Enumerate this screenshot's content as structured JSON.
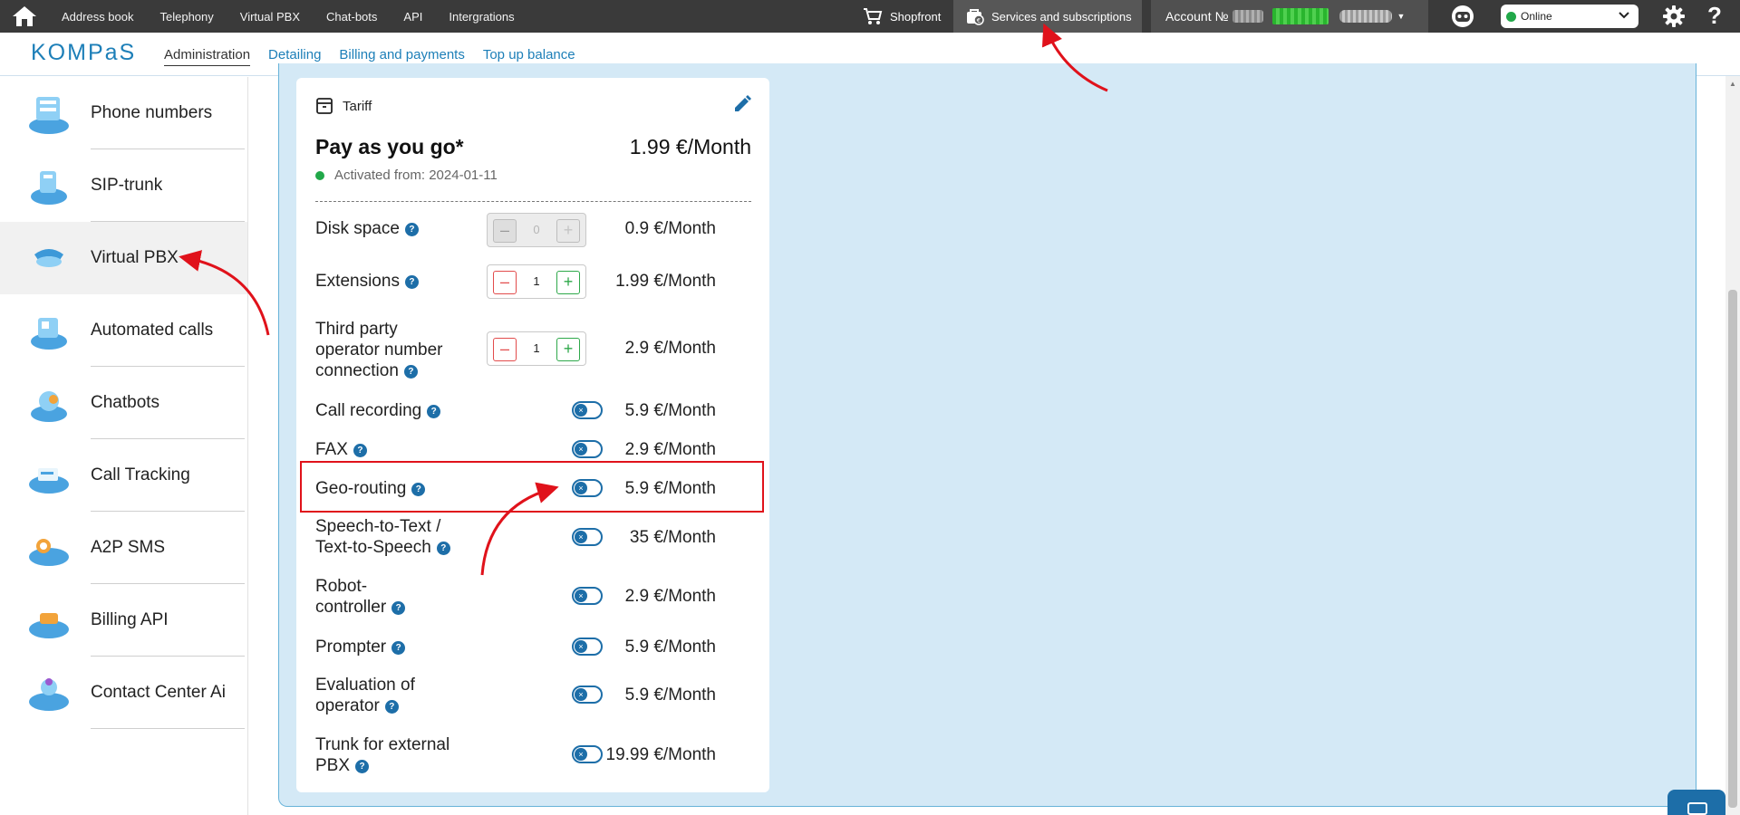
{
  "topbar": {
    "nav": [
      "Address book",
      "Telephony",
      "Virtual PBX",
      "Chat-bots",
      "API",
      "Intergrations"
    ],
    "shopfront": "Shopfront",
    "services": "Services and subscriptions",
    "account_label": "Account №",
    "status": "Online"
  },
  "logo": "KOMPaS",
  "subnav": [
    "Administration",
    "Detailing",
    "Billing and payments",
    "Top up balance"
  ],
  "sidebar": {
    "items": [
      {
        "label": "Phone numbers"
      },
      {
        "label": "SIP-trunk"
      },
      {
        "label": "Virtual PBX"
      },
      {
        "label": "Automated calls"
      },
      {
        "label": "Chatbots"
      },
      {
        "label": "Call Tracking"
      },
      {
        "label": "A2P SMS"
      },
      {
        "label": "Billing API"
      },
      {
        "label": "Contact Center Ai"
      }
    ]
  },
  "tariff": {
    "section_label": "Tariff",
    "plan_name": "Pay as you go*",
    "plan_price": "1.99 €/Month",
    "activated": "Activated from: 2024-01-11",
    "rows": [
      {
        "name": "Disk space",
        "price": "0.9 €/Month",
        "qty": "0"
      },
      {
        "name": "Extensions",
        "price": "1.99 €/Month",
        "qty": "1"
      },
      {
        "name_lines": [
          "Third party",
          "operator number",
          "connection"
        ],
        "price": "2.9 €/Month",
        "qty": "1"
      },
      {
        "name": "Call recording",
        "price": "5.9 €/Month"
      },
      {
        "name": "FAX",
        "price": "2.9 €/Month"
      },
      {
        "name": "Geo-routing",
        "price": "5.9 €/Month"
      },
      {
        "name_lines": [
          "Speech-to-Text /",
          "Text-to-Speech"
        ],
        "price": "35 €/Month"
      },
      {
        "name_lines": [
          "Robot-",
          "controller"
        ],
        "price": "2.9 €/Month"
      },
      {
        "name": "Prompter",
        "price": "5.9 €/Month"
      },
      {
        "name_lines": [
          "Evaluation of",
          "operator"
        ],
        "price": "5.9 €/Month"
      },
      {
        "name_lines": [
          "Trunk for external",
          "PBX"
        ],
        "price": "19.99 €/Month"
      }
    ]
  },
  "colors": {
    "topbar": "#3a3a3a",
    "accent": "#1d7fb8",
    "panel": "#d4e9f6",
    "highlight": "#e0121b",
    "online": "#21a849"
  }
}
